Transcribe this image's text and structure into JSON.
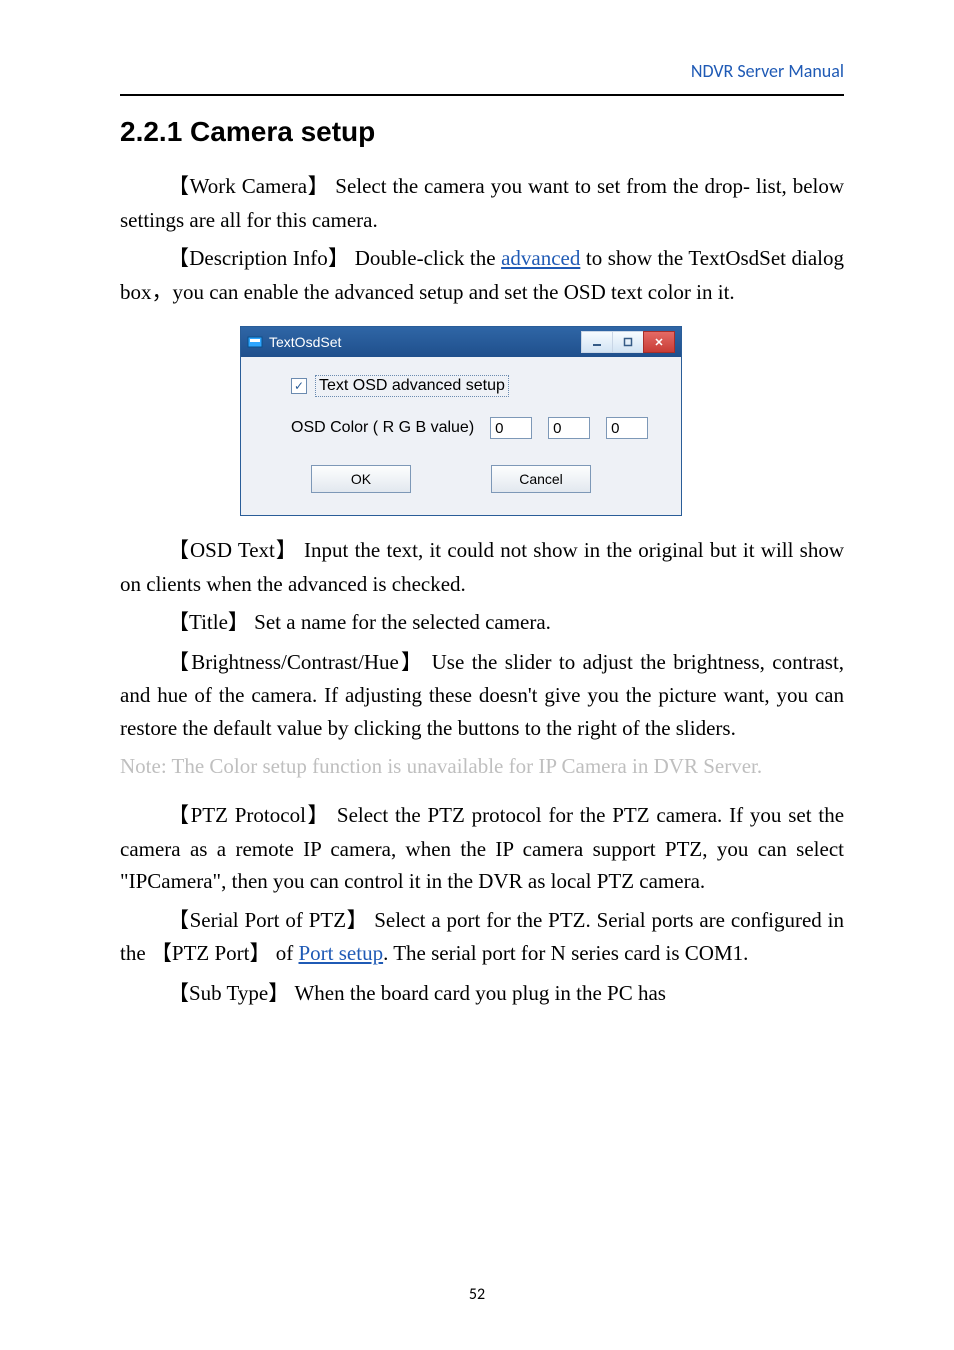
{
  "header": {
    "link_text": "NDVR Server Manual"
  },
  "section": {
    "heading": "2.2.1 Camera setup"
  },
  "p1": {
    "label_open": "【",
    "label": "Work Camera",
    "label_close": "】",
    "text": "Select the camera you want to set from the drop- list, below settings are all for this camera."
  },
  "p2": {
    "label_open": "【",
    "label": "Description Info",
    "label_close": "】",
    "text": "Double-click the ",
    "link": "advanced",
    "text2": " to show the TextOsdSet dialog box，you can enable the advanced setup and set the OSD text color in it."
  },
  "dialog": {
    "title": "TextOsdSet",
    "checkbox_label": "Text OSD advanced setup",
    "rgb_label": "OSD Color ( R G B value)",
    "r": "0",
    "g": "0",
    "b": "0",
    "ok": "OK",
    "cancel": "Cancel"
  },
  "p3": {
    "label_open": "【",
    "label": "OSD Text",
    "label_close": "】",
    "text": "Input the text, it could not show in the original but it will show on clients when the advanced is checked."
  },
  "p4": {
    "label_open": "【",
    "label": "Title",
    "label_close": "】",
    "text": "Set a name for the selected camera."
  },
  "p5": {
    "label_open": "【",
    "label": "Brightness/Contrast/Hue",
    "label_close": "】",
    "text": "Use the slider to adjust the brightness, contrast, and hue of the camera. If adjusting these doesn't give you the picture want, you can restore the default value by clicking the buttons to the right of the sliders."
  },
  "color_note": "Note: The Color setup function is unavailable for IP Camera in DVR Server.",
  "p6": {
    "label_open": "【",
    "label": "PTZ Protocol",
    "label_close": "】",
    "text": "Select the PTZ protocol for the PTZ camera. If you set the camera as a remote IP camera, when the IP camera support PTZ, you can select \"IPCamera\", then you can control it in the DVR as local PTZ camera."
  },
  "p7": {
    "label_open": "【",
    "label": "Serial Port of PTZ",
    "label_close": "】",
    "text": "Select a port for the PTZ. Serial ports are configured in the ",
    "inner_open": "【",
    "inner_label": "PTZ Port",
    "inner_close": "】",
    "text2": " of ",
    "link": "Port setup",
    "text3": ". The serial port for N series card is COM1."
  },
  "p8": {
    "label_open": "【",
    "label": "Sub Type",
    "label_close": "】",
    "text": "When the board card you plug in the PC has"
  },
  "pagenum": "52"
}
